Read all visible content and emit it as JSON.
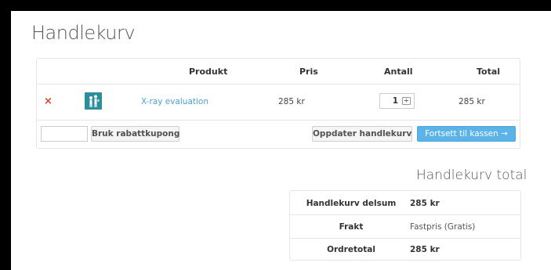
{
  "page": {
    "title": "Handlekurv"
  },
  "cart": {
    "headers": {
      "product": "Produkt",
      "price": "Pris",
      "quantity": "Antall",
      "total": "Total"
    },
    "items": [
      {
        "remove": "×",
        "thumbnail_icon": "people-icon",
        "name": "X-ray evaluation",
        "price": "285 kr",
        "quantity": "1",
        "total": "285 kr"
      }
    ],
    "coupon_placeholder": "",
    "apply_coupon_label": "Bruk rabattkupong",
    "update_cart_label": "Oppdater handlekurv",
    "checkout_label": "Fortsett til kassen →"
  },
  "totals": {
    "title": "Handlekurv total",
    "rows": [
      {
        "label": "Handlekurv delsum",
        "value": "285 kr"
      },
      {
        "label": "Frakt",
        "value": "Fastpris (Gratis)"
      },
      {
        "label": "Ordretotal",
        "value": "285 kr"
      }
    ]
  },
  "colors": {
    "accent": "#5bb3e8",
    "link": "#4a9fd6",
    "remove": "#e2401c",
    "thumb": "#2c8d9c"
  }
}
